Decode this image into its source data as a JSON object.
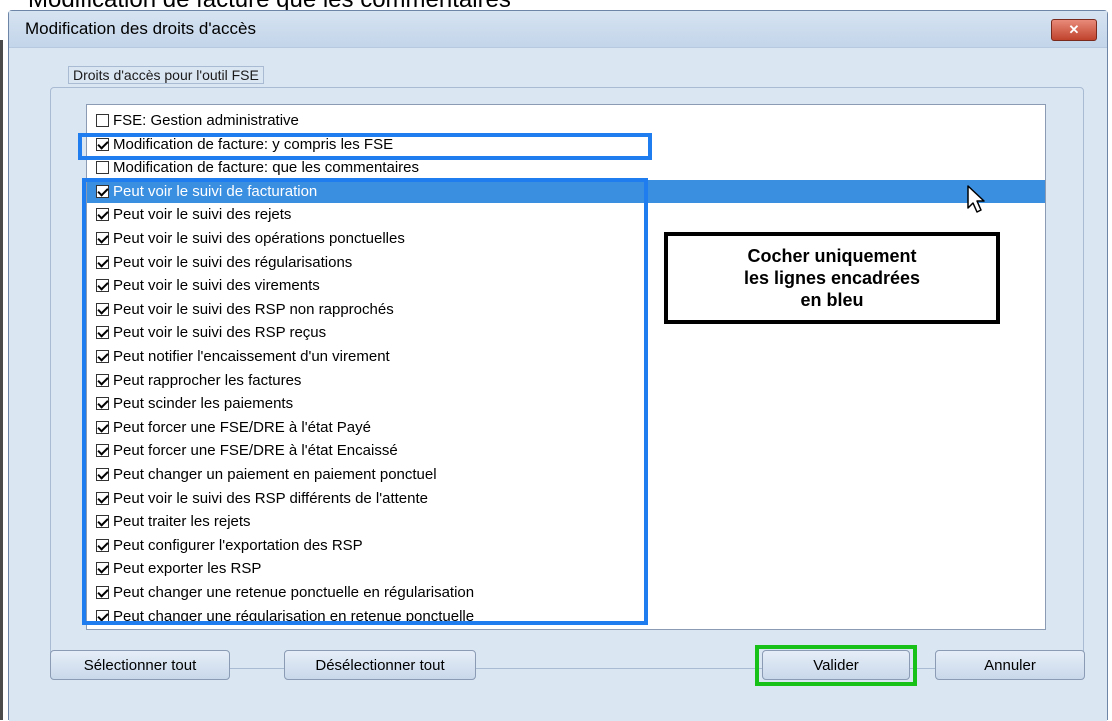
{
  "caption": "Modification de facture que les commentaires",
  "window": {
    "title": "Modification des droits d'accès",
    "close_glyph": "✕"
  },
  "group": {
    "label": "Droits d'accès pour l'outil FSE"
  },
  "items": [
    {
      "label": "FSE: Gestion administrative",
      "checked": false,
      "selected": false
    },
    {
      "label": "Modification de facture: y compris les FSE",
      "checked": true,
      "selected": false
    },
    {
      "label": "Modification de facture: que les commentaires",
      "checked": false,
      "selected": false
    },
    {
      "label": "Peut voir le suivi de facturation",
      "checked": true,
      "selected": true
    },
    {
      "label": "Peut voir le suivi des rejets",
      "checked": true,
      "selected": false
    },
    {
      "label": "Peut voir le suivi des opérations ponctuelles",
      "checked": true,
      "selected": false
    },
    {
      "label": "Peut voir le suivi des régularisations",
      "checked": true,
      "selected": false
    },
    {
      "label": "Peut voir le suivi des virements",
      "checked": true,
      "selected": false
    },
    {
      "label": "Peut voir le suivi des RSP non rapprochés",
      "checked": true,
      "selected": false
    },
    {
      "label": "Peut voir le suivi des RSP reçus",
      "checked": true,
      "selected": false
    },
    {
      "label": "Peut notifier l'encaissement d'un virement",
      "checked": true,
      "selected": false
    },
    {
      "label": "Peut rapprocher les factures",
      "checked": true,
      "selected": false
    },
    {
      "label": "Peut scinder les paiements",
      "checked": true,
      "selected": false
    },
    {
      "label": "Peut forcer une FSE/DRE à l'état Payé",
      "checked": true,
      "selected": false
    },
    {
      "label": "Peut forcer une FSE/DRE à l'état Encaissé",
      "checked": true,
      "selected": false
    },
    {
      "label": "Peut changer un paiement en paiement ponctuel",
      "checked": true,
      "selected": false
    },
    {
      "label": "Peut voir le suivi des RSP différents de l'attente",
      "checked": true,
      "selected": false
    },
    {
      "label": "Peut traiter les rejets",
      "checked": true,
      "selected": false
    },
    {
      "label": "Peut configurer l'exportation des RSP",
      "checked": true,
      "selected": false
    },
    {
      "label": "Peut exporter les RSP",
      "checked": true,
      "selected": false
    },
    {
      "label": "Peut changer une retenue ponctuelle en régularisation",
      "checked": true,
      "selected": false
    },
    {
      "label": "Peut changer une régularisation en retenue ponctuelle",
      "checked": true,
      "selected": false
    }
  ],
  "note": {
    "line1": "Cocher uniquement",
    "line2": "les lignes encadrées",
    "line3": "en bleu"
  },
  "buttons": {
    "select_all": "Sélectionner tout",
    "deselect_all": "Désélectionner tout",
    "validate": "Valider",
    "cancel": "Annuler"
  },
  "colors": {
    "annotation_blue": "#1f7df0",
    "annotation_green": "#17c117",
    "selection": "#3b8fe0"
  }
}
